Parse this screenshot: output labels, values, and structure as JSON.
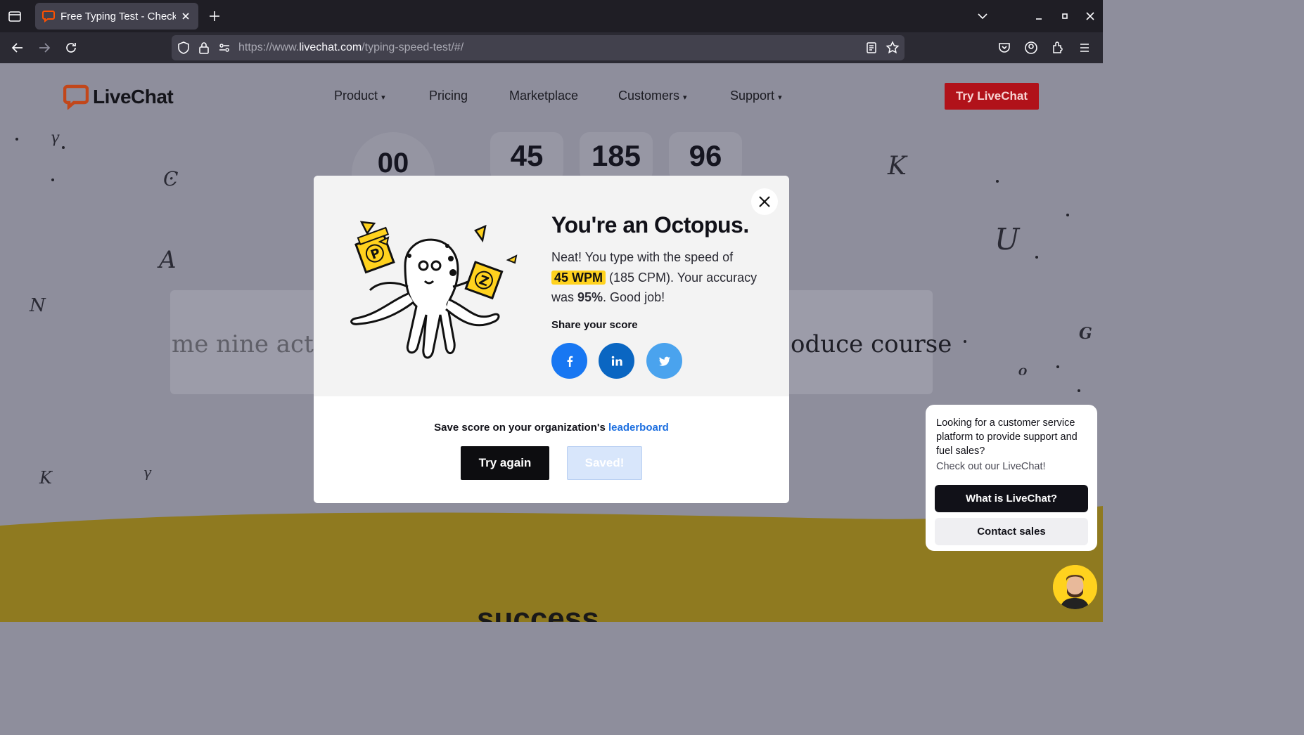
{
  "browser": {
    "tab_title": "Free Typing Test - Check",
    "url_prefix": "https://www.",
    "url_domain": "livechat.com",
    "url_path": "/typing-speed-test/#/"
  },
  "header": {
    "logo_text": "LiveChat",
    "menu": [
      {
        "label": "Product",
        "caret": "▾"
      },
      {
        "label": "Pricing"
      },
      {
        "label": "Marketplace"
      },
      {
        "label": "Customers",
        "caret": "▾"
      },
      {
        "label": "Support",
        "caret": "▾"
      }
    ],
    "cta": "Try LiveChat"
  },
  "stats": {
    "timer": "00",
    "wpm": "45",
    "cpm": "185",
    "accuracy": "96"
  },
  "typing": {
    "left_text": "me nine act t",
    "right_text": "oduce course"
  },
  "modal": {
    "title": "You're an Octopus.",
    "text_1": "Neat! You type with the speed of",
    "wpm_badge": "45 WPM",
    "text_2": " (185 CPM). Your accuracy was ",
    "accuracy": "95%",
    "text_3": ". Good job!",
    "share_label": "Share your score",
    "social": [
      "facebook-icon",
      "linkedin-icon",
      "twitter-icon"
    ],
    "save_text": "Save score on your organization's ",
    "save_link": "leaderboard",
    "try_again": "Try again",
    "saved": "Saved!"
  },
  "chat": {
    "question": "Looking for a customer service platform to provide support and fuel sales?",
    "sub": "Check out our LiveChat!",
    "btn_primary": "What is LiveChat?",
    "btn_secondary": "Contact sales"
  },
  "section_heading": "success",
  "colors": {
    "accent_red": "#b1121a",
    "highlight_yellow": "#ffd21e",
    "facebook": "#1877f2",
    "linkedin": "#0a66c2",
    "twitter": "#4aa3ee"
  }
}
